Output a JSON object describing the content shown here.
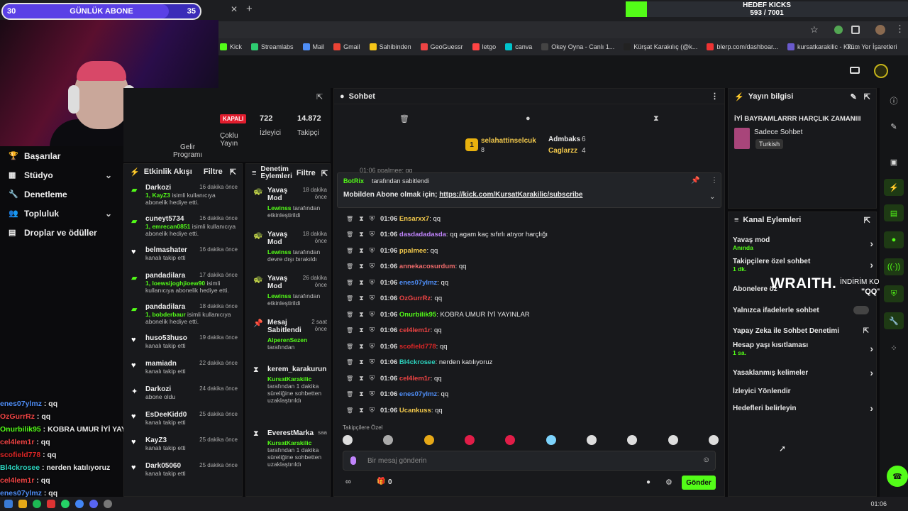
{
  "overlay": {
    "sub_start": "30",
    "sub_label": "GÜNLÜK ABONE",
    "sub_goal": "35",
    "kicks_label": "HEDEF KICKS",
    "kicks_progress": "593 / 7001",
    "tab_partial": "ekilisler",
    "wraith": "WRAITH.",
    "discount_label": "İNDİRİM KODU:",
    "discount_code": "\"QQ\""
  },
  "bookmarks": [
    "Kick",
    "Streamlabs",
    "Mail",
    "Gmail",
    "Sahibinden",
    "GeoGuessr",
    "letgo",
    "canva",
    "Okey Oyna - Canlı 1...",
    "Kürşat Karakılıç (@k...",
    "blerp.com/dashboar...",
    "kursatkarakilic - Kic..."
  ],
  "bookmarks_all": "Tüm Yer İşaretleri",
  "nav": [
    {
      "label": "Başarılar"
    },
    {
      "label": "Stüdyo"
    },
    {
      "label": "Denetleme"
    },
    {
      "label": "Topluluk"
    },
    {
      "label": "Droplar ve ödüller"
    }
  ],
  "stats": {
    "status": "KAPALI",
    "viewers": "722",
    "viewers_label": "İzleyici",
    "followers": "14.872",
    "followers_label": "Takipçi",
    "multi": "Çoklu",
    "multi2": "Yayın",
    "gelir": "Gelir",
    "gelir2": "Programı"
  },
  "activity": {
    "title": "Etkinlik Akışı",
    "filter": "Filtre",
    "items": [
      {
        "name": "Darkozi",
        "time": "16 dakika önce",
        "line": "1, KayZ3 ",
        "rest": "isimli kullanıcıya abonelik hediye etti.",
        "icon": "gift"
      },
      {
        "name": "cuneyt5734",
        "time": "16 dakika önce",
        "line": "1, emrecan0851 ",
        "rest": "isimli kullanıcıya abonelik hediye etti.",
        "icon": "gift"
      },
      {
        "name": "belmashater",
        "time": "16 dakika önce",
        "line": "",
        "rest": "kanalı takip etti",
        "icon": "heart"
      },
      {
        "name": "pandadilara",
        "time": "17 dakika önce",
        "line": "1, loewsijoghjioew90 ",
        "rest": "isimli kullanıcıya abonelik hediye etti.",
        "icon": "gift"
      },
      {
        "name": "pandadilara",
        "time": "18 dakika önce",
        "line": "1, bobderbaur ",
        "rest": "isimli kullanıcıya abonelik hediye etti.",
        "icon": "gift"
      },
      {
        "name": "huso53huso",
        "time": "19 dakika önce",
        "line": "",
        "rest": "kanalı takip etti",
        "icon": "heart"
      },
      {
        "name": "mamiadn",
        "time": "22 dakika önce",
        "line": "",
        "rest": "kanalı takip etti",
        "icon": "heart"
      },
      {
        "name": "Darkozi",
        "time": "24 dakika önce",
        "line": "",
        "rest": "abone oldu",
        "icon": "star"
      },
      {
        "name": "EsDeeKidd0",
        "time": "25 dakika önce",
        "line": "",
        "rest": "kanalı takip etti",
        "icon": "heart"
      },
      {
        "name": "KayZ3",
        "time": "25 dakika önce",
        "line": "",
        "rest": "kanalı takip etti",
        "icon": "heart"
      },
      {
        "name": "Dark05060",
        "time": "25 dakika önce",
        "line": "",
        "rest": "kanalı takip etti",
        "icon": "heart"
      }
    ]
  },
  "mod": {
    "title": "Denetim",
    "title2": "Eylemleri",
    "filter": "Filtre",
    "items": [
      {
        "t1": "Yavaş",
        "t1b": "Mod",
        "time": "18 dakika",
        "time2": "önce",
        "who": "Lewinss",
        "desc": "tarafından etkinleştirildi"
      },
      {
        "t1": "Yavaş",
        "t1b": "Mod",
        "time": "18 dakika",
        "time2": "önce",
        "who": "Lewinss",
        "desc": "tarafından devre dışı bırakıldı"
      },
      {
        "t1": "Yavaş",
        "t1b": "Mod",
        "time": "26 dakika",
        "time2": "önce",
        "who": "Lewinss",
        "desc": "tarafından etkinleştirildi"
      },
      {
        "t1": "Mesaj",
        "t1b": "Sabitlendi",
        "time": "2 saat",
        "time2": "önce",
        "who": "AlperenSezen",
        "desc": "tarafından"
      },
      {
        "t1": "kerem_karakurun",
        "t1b": "",
        "time": "",
        "time2": "",
        "who": "KursatKarakilic",
        "desc": "tarafından 1 dakika süreliğine sohbetten uzaklaştırıldı"
      },
      {
        "t1": "EverestMarka",
        "t1b": "",
        "time": "saa",
        "time2": "",
        "who": "KursatKarakilic",
        "desc": "tarafından 1 dakika süreliğine sohbetten uzaklaştırıldı"
      }
    ]
  },
  "chat": {
    "title": "Sohbet",
    "top1": "selahattinselcuk",
    "top1n": "8",
    "top2": "Admbaks",
    "top2n": "6",
    "top3": "Caglarzz",
    "top3n": "4",
    "peek": "01:06 ppalmee: qq",
    "pin_by": "BotRix",
    "pin_by_suffix": "tarafından sabitlendi",
    "pin_text": "Mobilden Abone olmak için; ",
    "pin_link": "https://kick.com/KursatKarakilic/subscribe",
    "messages": [
      {
        "time": "01:06",
        "user": "Ensarxx7",
        "text": ": qq",
        "color": "#f2c94c"
      },
      {
        "time": "01:06",
        "user": "dasdadadasda",
        "text": ": qq agam kaç sıfırlı atıyor harçlığı",
        "color": "#c084fc"
      },
      {
        "time": "01:06",
        "user": "ppalmee",
        "text": ": qq",
        "color": "#f2c94c"
      },
      {
        "time": "01:06",
        "user": "annekacosurdum",
        "text": ": qq",
        "color": "#ef6b6b"
      },
      {
        "time": "01:06",
        "user": "enes07ylmz",
        "text": ": qq",
        "color": "#4f8ef7"
      },
      {
        "time": "01:06",
        "user": "OzGurrRz",
        "text": ": qq",
        "color": "#ef4444"
      },
      {
        "time": "01:06",
        "user": "Onurbilik95",
        "text": ": KOBRA UMUR İYİ YAYINLAR",
        "color": "#53fc18"
      },
      {
        "time": "01:06",
        "user": "cel4lem1r",
        "text": ": qq",
        "color": "#ef4444"
      },
      {
        "time": "01:06",
        "user": "scofield778",
        "text": ": qq",
        "color": "#dc2626"
      },
      {
        "time": "01:06",
        "user": "Bl4ckrosee",
        "text": ": nerden katılıyoruz",
        "color": "#2dd4bf"
      },
      {
        "time": "01:06",
        "user": "cel4lem1r",
        "text": ": qq",
        "color": "#ef4444"
      },
      {
        "time": "01:06",
        "user": "enes07ylmz",
        "text": ": qq",
        "color": "#4f8ef7"
      },
      {
        "time": "01:06",
        "user": "Ucankuss",
        "text": ": qq",
        "color": "#f2c94c"
      }
    ],
    "emote_label": "Takipçilere Özel",
    "input_placeholder": "Bir mesaj gönderin",
    "points": "0",
    "send": "Gönder"
  },
  "info": {
    "title": "Yayın bilgisi",
    "stream_title": "İYİ BAYRAMLARRR HARÇLIK ZAMANIII",
    "category": "Sadece Sohbet",
    "lang": "Turkish"
  },
  "kanal": {
    "title": "Kanal Eylemleri",
    "items": [
      {
        "label": "Yavaş mod",
        "sub": "Anında",
        "kind": "chev"
      },
      {
        "label": "Takipçilere özel sohbet",
        "sub": "1 dk.",
        "kind": "chev"
      },
      {
        "label": "Abonelere öz",
        "sub": "",
        "kind": "none"
      },
      {
        "label": "Yalnızca ifadelerle sohbet",
        "sub": "",
        "kind": "toggle"
      },
      {
        "label": "Yapay Zeka ile Sohbet Denetimi",
        "sub": "",
        "kind": "ext"
      },
      {
        "label": "Hesap yaşı kısıtlaması",
        "sub": "1 sa.",
        "kind": "chev"
      },
      {
        "label": "Yasaklanmış kelimeler",
        "sub": "",
        "kind": "chev"
      },
      {
        "label": "İzleyici Yönlendir",
        "sub": "",
        "kind": "none"
      },
      {
        "label": "Hedefleri belirleyin",
        "sub": "",
        "kind": "chev"
      }
    ]
  },
  "overlay_chat": [
    {
      "user": "enes07ylmz",
      "text": " : qq",
      "color": "#4f8ef7"
    },
    {
      "user": "OzGurrRz",
      "text": " : qq",
      "color": "#ef4444"
    },
    {
      "user": "Onurbilik95",
      "text": " : KOBRA UMUR İYİ YAYINLAR",
      "color": "#53fc18"
    },
    {
      "user": "cel4lem1r",
      "text": " : qq",
      "color": "#ef4444"
    },
    {
      "user": "scofield778",
      "text": " : qq",
      "color": "#dc2626"
    },
    {
      "user": "Bl4ckrosee",
      "text": " : nerden katılıyoruz",
      "color": "#2dd4bf"
    },
    {
      "user": "cel4lem1r",
      "text": " : qq",
      "color": "#ef4444"
    },
    {
      "user": "enes07ylmz",
      "text": " : qq",
      "color": "#4f8ef7"
    }
  ],
  "clock": "01:06"
}
